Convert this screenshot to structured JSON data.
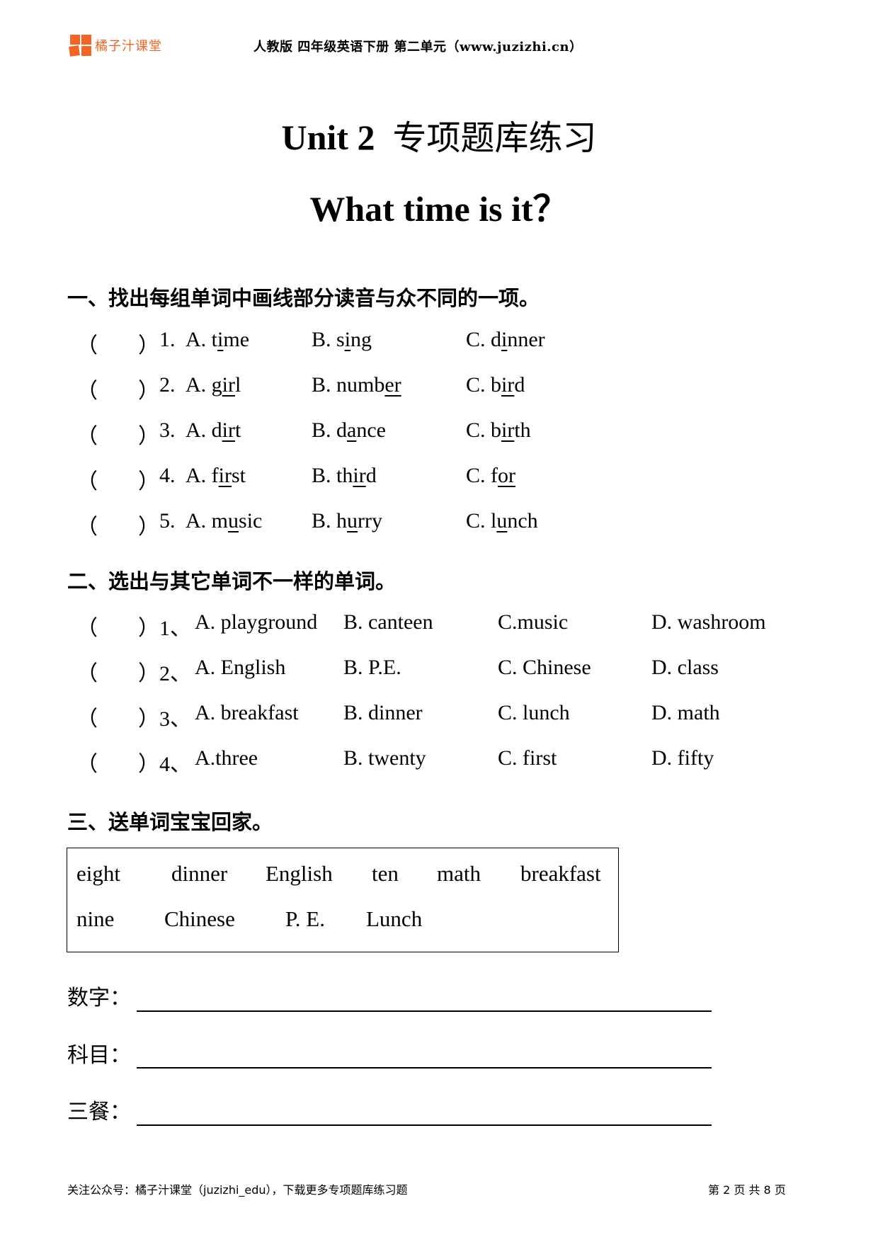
{
  "header": {
    "logo_text": "橘子汁课堂",
    "caption": "人教版 四年级英语下册 第二单元（www.juzizhi.cn）",
    "brand_color": "#f26522"
  },
  "title": {
    "line1_en": "Unit 2",
    "line1_zh": "专项题库练习",
    "line2": "What time is it？"
  },
  "section1": {
    "heading": "一、找出每组单词中画线部分读音与众不同的一项。",
    "paren_open": "（",
    "paren_close": "）",
    "items": [
      {
        "num": "1.",
        "options": [
          {
            "label": "A. ",
            "pre": "t",
            "ul": "i",
            "post": "me"
          },
          {
            "label": "B. ",
            "pre": "s",
            "ul": "i",
            "post": "ng"
          },
          {
            "label": "C. ",
            "pre": "d",
            "ul": "i",
            "post": "nner"
          }
        ]
      },
      {
        "num": "2.",
        "options": [
          {
            "label": "A. ",
            "pre": "g",
            "ul": "ir",
            "post": "l"
          },
          {
            "label": "B. ",
            "pre": "numb",
            "ul": "er",
            "post": ""
          },
          {
            "label": "C. ",
            "pre": "b",
            "ul": "ir",
            "post": "d"
          }
        ]
      },
      {
        "num": "3.",
        "options": [
          {
            "label": "A. ",
            "pre": "d",
            "ul": "ir",
            "post": "t"
          },
          {
            "label": "B. ",
            "pre": "d",
            "ul": "a",
            "post": "nce"
          },
          {
            "label": "C. ",
            "pre": "b",
            "ul": "ir",
            "post": "th"
          }
        ]
      },
      {
        "num": "4.",
        "options": [
          {
            "label": "A. ",
            "pre": "f",
            "ul": "ir",
            "post": "st"
          },
          {
            "label": "B. ",
            "pre": "th",
            "ul": "ir",
            "post": "d"
          },
          {
            "label": "C. ",
            "pre": "f",
            "ul": "or",
            "post": ""
          }
        ]
      },
      {
        "num": "5.",
        "options": [
          {
            "label": "A. ",
            "pre": "m",
            "ul": "u",
            "post": "sic"
          },
          {
            "label": "B. ",
            "pre": "h",
            "ul": "u",
            "post": "rry"
          },
          {
            "label": "C. ",
            "pre": "l",
            "ul": "u",
            "post": "nch"
          }
        ]
      }
    ]
  },
  "section2": {
    "heading": "二、选出与其它单词不一样的单词。",
    "items": [
      {
        "num": "1、",
        "options": [
          "A. playground",
          "B. canteen",
          "C.music",
          "D. washroom"
        ]
      },
      {
        "num": "2、",
        "options": [
          "A. English",
          "B. P.E.",
          "C. Chinese",
          "D. class"
        ]
      },
      {
        "num": "3、",
        "options": [
          "A. breakfast",
          "B. dinner",
          "C. lunch",
          "D. math"
        ]
      },
      {
        "num": "4、",
        "options": [
          "A.three",
          "B. twenty",
          "C. first",
          "D. fifty"
        ]
      }
    ]
  },
  "section3": {
    "heading": "三、送单词宝宝回家。",
    "words_row1": [
      "eight",
      "dinner",
      "English",
      "ten",
      "math",
      "breakfast"
    ],
    "words_row2": [
      "nine",
      "Chinese",
      "P. E.",
      "Lunch"
    ],
    "fill_labels": [
      "数字：",
      "科目：",
      "三餐："
    ]
  },
  "footer": {
    "left": "关注公众号：橘子汁课堂（juzizhi_edu），下载更多专项题库练习题",
    "page_prefix": "第 ",
    "page_current": "2",
    "page_mid": " 页 共 ",
    "page_total": "8",
    "page_suffix": " 页"
  }
}
